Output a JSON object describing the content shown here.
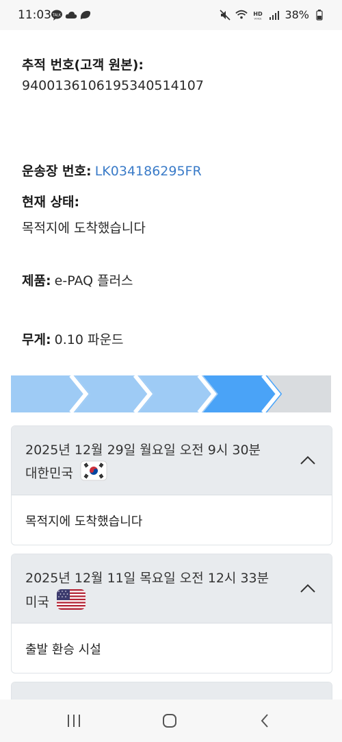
{
  "status_bar": {
    "time": "11:03",
    "battery": "38%",
    "icons_left": [
      "talk-icon",
      "cloud-icon",
      "leaf-icon"
    ],
    "icons_right": [
      "mute-icon",
      "wifi-icon",
      "hd-voice-icon",
      "signal-icon",
      "battery-icon"
    ]
  },
  "tracking": {
    "tracking_label": "추적 번호(고객 원본):",
    "tracking_number": "9400136106195340514107",
    "waybill_label": "운송장 번호:",
    "waybill_number": "LK034186295FR",
    "status_label": "현재 상태:",
    "status_value": "목적지에 도착했습니다",
    "product_label": "제품:",
    "product_value": "e-PAQ 플러스",
    "weight_label": "무게:",
    "weight_value": "0.10 파운드"
  },
  "progress": {
    "steps_total": 5,
    "steps_done": 4,
    "current_step": 4,
    "colors": {
      "done": "#9ecbf5",
      "current": "#4aa3f7",
      "pending": "#d9dcdf"
    }
  },
  "events": [
    {
      "date": "2025년 12월 29일 월요일 오전 9시 30분",
      "country": "대한민국",
      "flag": "korea-flag-icon",
      "status": "목적지에 도착했습니다"
    },
    {
      "date": "2025년 12월 11일 목요일 오전 12시 33분",
      "country": "미국",
      "flag": "usa-flag-icon",
      "status": "출발 환승 시설"
    }
  ],
  "nav": {
    "buttons": [
      "recents-icon",
      "home-icon",
      "back-icon"
    ]
  }
}
